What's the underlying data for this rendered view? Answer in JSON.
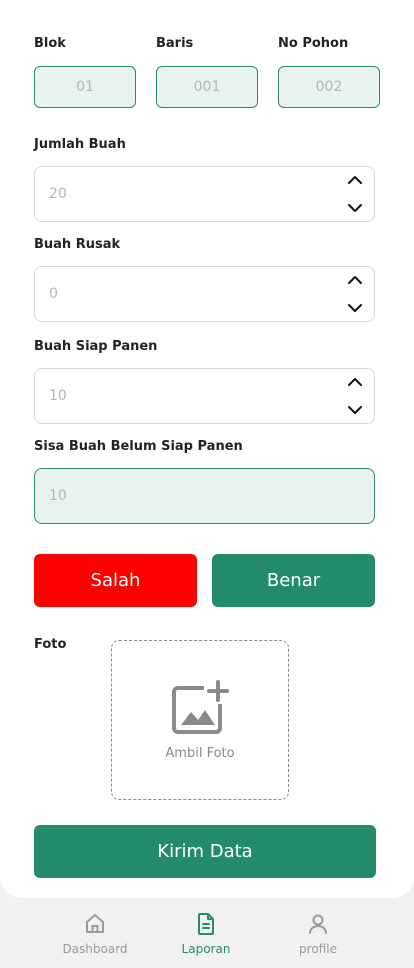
{
  "location": {
    "blok": {
      "label": "Blok",
      "value": "01"
    },
    "baris": {
      "label": "Baris",
      "value": "001"
    },
    "pohon": {
      "label": "No Pohon",
      "value": "002"
    }
  },
  "fields": {
    "jumlah_buah": {
      "label": "Jumlah Buah",
      "value": "20"
    },
    "buah_rusak": {
      "label": "Buah Rusak",
      "value": "0"
    },
    "buah_siap_panen": {
      "label": "Buah Siap Panen",
      "value": "10"
    },
    "sisa_buah": {
      "label": "Sisa Buah Belum Siap Panen",
      "value": "10"
    }
  },
  "actions": {
    "salah": "Salah",
    "benar": "Benar",
    "kirim": "Kirim Data"
  },
  "photo": {
    "label": "Foto",
    "caption": "Ambil Foto",
    "icon": "add-photo-icon"
  },
  "bottom_nav": {
    "items": [
      {
        "label": "Dashboard",
        "icon": "home-icon",
        "active": false
      },
      {
        "label": "Laporan",
        "icon": "document-icon",
        "active": true
      },
      {
        "label": "profile",
        "icon": "user-icon",
        "active": false
      }
    ]
  },
  "colors": {
    "accent": "#238b6c",
    "danger": "#ff0000",
    "muted_fill": "#e9f3ee"
  }
}
